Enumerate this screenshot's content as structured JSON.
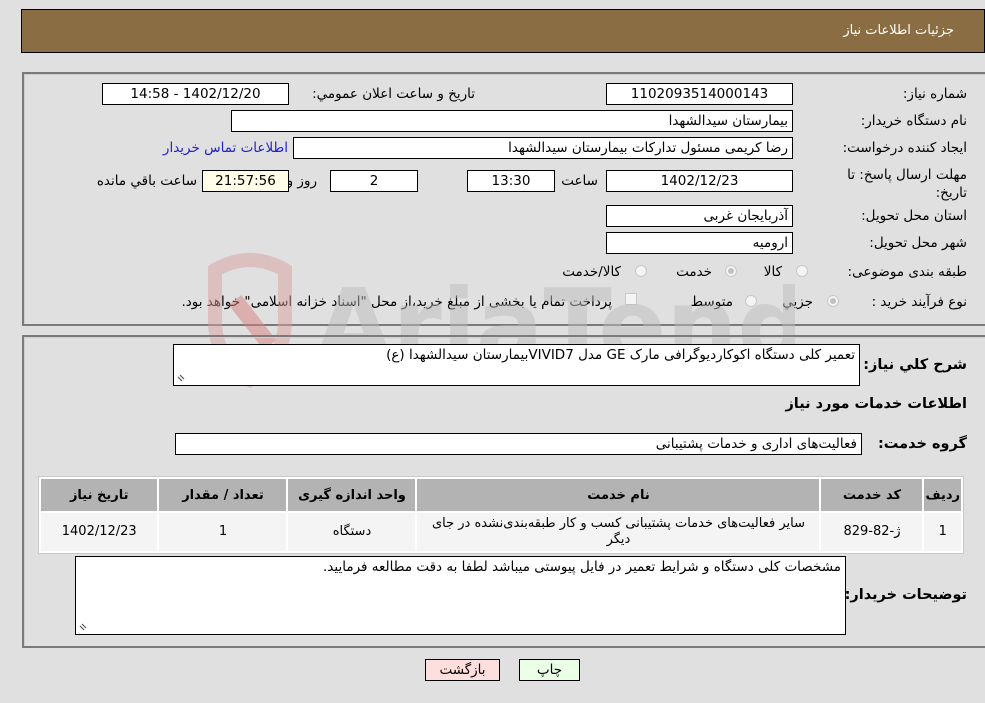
{
  "header": {
    "title": "جزئیات اطلاعات نیاز"
  },
  "info": {
    "need_number_label": "شماره نیاز:",
    "need_number": "1102093514000143",
    "announce_label": "تاریخ و ساعت اعلان عمومي:",
    "announce_value": "1402/12/20 - 14:58",
    "buyer_org_label": "نام دستگاه خریدار:",
    "buyer_org": "بیمارستان سیدالشهدا",
    "creator_label": "ایجاد کننده درخواست:",
    "creator": "رضا کریمی مسئول تدارکات بیمارستان سیدالشهدا",
    "contact_link": "اطلاعات تماس خریدار",
    "deadline_label": "مهلت ارسال پاسخ: تا تاریخ:",
    "deadline_date": "1402/12/23",
    "time_label": "ساعت",
    "deadline_time": "13:30",
    "days_value": "2",
    "days_label": "روز و",
    "remaining_time": "21:57:56",
    "remaining_label": "ساعت باقي مانده",
    "province_label": "استان محل تحویل:",
    "province": "آذربایجان غربی",
    "city_label": "شهر محل تحویل:",
    "city": "ارومیه",
    "category_label": "طبقه بندی موضوعی:",
    "category_options": [
      {
        "label": "کالا",
        "checked": false
      },
      {
        "label": "خدمت",
        "checked": true
      },
      {
        "label": "کالا/خدمت",
        "checked": false
      }
    ],
    "process_label": "نوع فرآیند خرید :",
    "process_options": [
      {
        "label": "جزیي",
        "checked": true
      },
      {
        "label": "متوسط",
        "checked": false
      }
    ],
    "treasury_note": "پرداخت تمام یا بخشی از مبلغ خرید،از محل \"اسناد خزانه اسلامی\" خواهد بود."
  },
  "details": {
    "description_label": "شرح کلي نیاز:",
    "description": "تعمیر کلی دستگاه اکوکاردیوگرافی مارک GE مدل VIVID7بیمارستان سیدالشهدا (ع)",
    "services_heading": "اطلاعات خدمات مورد نیاز",
    "service_group_label": "گروه خدمت:",
    "service_group": "فعالیت‌های اداری و خدمات پشتیبانی",
    "table": {
      "headers": [
        "ردیف",
        "کد خدمت",
        "نام خدمت",
        "واحد اندازه گیری",
        "تعداد / مقدار",
        "تاریخ نیاز"
      ],
      "rows": [
        [
          "1",
          "ژ-82-829",
          "سایر فعالیت‌های خدمات پشتیبانی کسب و کار طبقه‌بندی‌نشده در جای دیگر",
          "دستگاه",
          "1",
          "1402/12/23"
        ]
      ]
    },
    "buyer_notes_label": "توضیحات خریدار:",
    "buyer_notes": "مشخصات کلی دستگاه و شرایط تعمیر در فایل پیوستی میباشد لطفا به دقت مطالعه فرمایید."
  },
  "buttons": {
    "print": "چاپ",
    "back": "بازگشت"
  },
  "watermark": {
    "text": "AriaTender.neT"
  }
}
